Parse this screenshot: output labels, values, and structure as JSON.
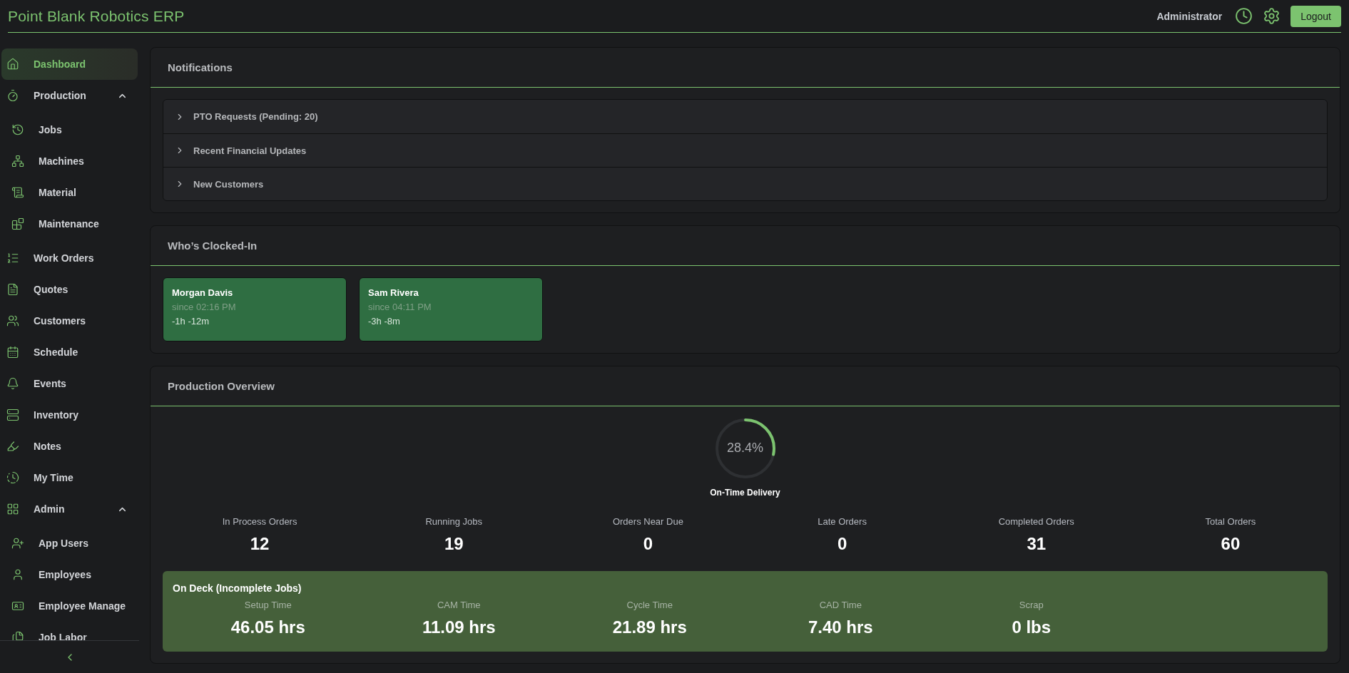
{
  "app": {
    "title": "Point Blank Robotics ERP",
    "user": "Administrator",
    "logout": "Logout"
  },
  "sidebar": {
    "items": [
      {
        "label": "Dashboard",
        "selected": true
      },
      {
        "label": "Production",
        "selected": false,
        "expanded": true,
        "children": [
          {
            "label": "Jobs",
            "selected": false
          },
          {
            "label": "Machines",
            "selected": false
          },
          {
            "label": "Material",
            "selected": false
          },
          {
            "label": "Maintenance",
            "selected": false
          }
        ]
      },
      {
        "label": "Work Orders",
        "selected": false
      },
      {
        "label": "Quotes",
        "selected": false
      },
      {
        "label": "Customers",
        "selected": false
      },
      {
        "label": "Schedule",
        "selected": false
      },
      {
        "label": "Events",
        "selected": false
      },
      {
        "label": "Inventory",
        "selected": false
      },
      {
        "label": "Notes",
        "selected": false
      },
      {
        "label": "My Time",
        "selected": false
      },
      {
        "label": "Admin",
        "selected": false,
        "expanded": true,
        "children": [
          {
            "label": "App Users",
            "selected": false
          },
          {
            "label": "Employees",
            "selected": false
          },
          {
            "label": "Employee Manage",
            "selected": false
          },
          {
            "label": "Job Labor",
            "selected": false
          }
        ]
      }
    ]
  },
  "notifications": {
    "title": "Notifications",
    "items": [
      {
        "label": "PTO Requests (Pending: 20)",
        "expanded": false
      },
      {
        "label": "Recent Financial Updates",
        "expanded": false
      },
      {
        "label": "New Customers",
        "expanded": false
      }
    ]
  },
  "clocked_in": {
    "title": "Who’s Clocked-In",
    "people": [
      {
        "name": "Morgan Davis",
        "since": "since 02:16 PM",
        "duration": "-1h -12m"
      },
      {
        "name": "Sam Rivera",
        "since": "since 04:11 PM",
        "duration": "-3h -8m"
      }
    ]
  },
  "production_overview": {
    "title": "Production Overview",
    "on_time": {
      "level": 0.284,
      "reading": "28.4%",
      "label": "On-Time Delivery"
    },
    "stats": [
      {
        "label": "In Process Orders",
        "value": "12"
      },
      {
        "label": "Running Jobs",
        "value": "19"
      },
      {
        "label": "Orders Near Due",
        "value": "0"
      },
      {
        "label": "Late Orders",
        "value": "0"
      },
      {
        "label": "Completed Orders",
        "value": "31"
      },
      {
        "label": "Total Orders",
        "value": "60"
      }
    ],
    "on_deck": {
      "title": "On Deck (Incomplete Jobs)",
      "stats": [
        {
          "label": "Setup Time",
          "value": "46.05 hrs"
        },
        {
          "label": "CAM Time",
          "value": "11.09 hrs"
        },
        {
          "label": "Cycle Time",
          "value": "21.89 hrs"
        },
        {
          "label": "CAD Time",
          "value": "7.40 hrs"
        },
        {
          "label": "Scrap",
          "value": "0 lbs"
        }
      ]
    }
  }
}
